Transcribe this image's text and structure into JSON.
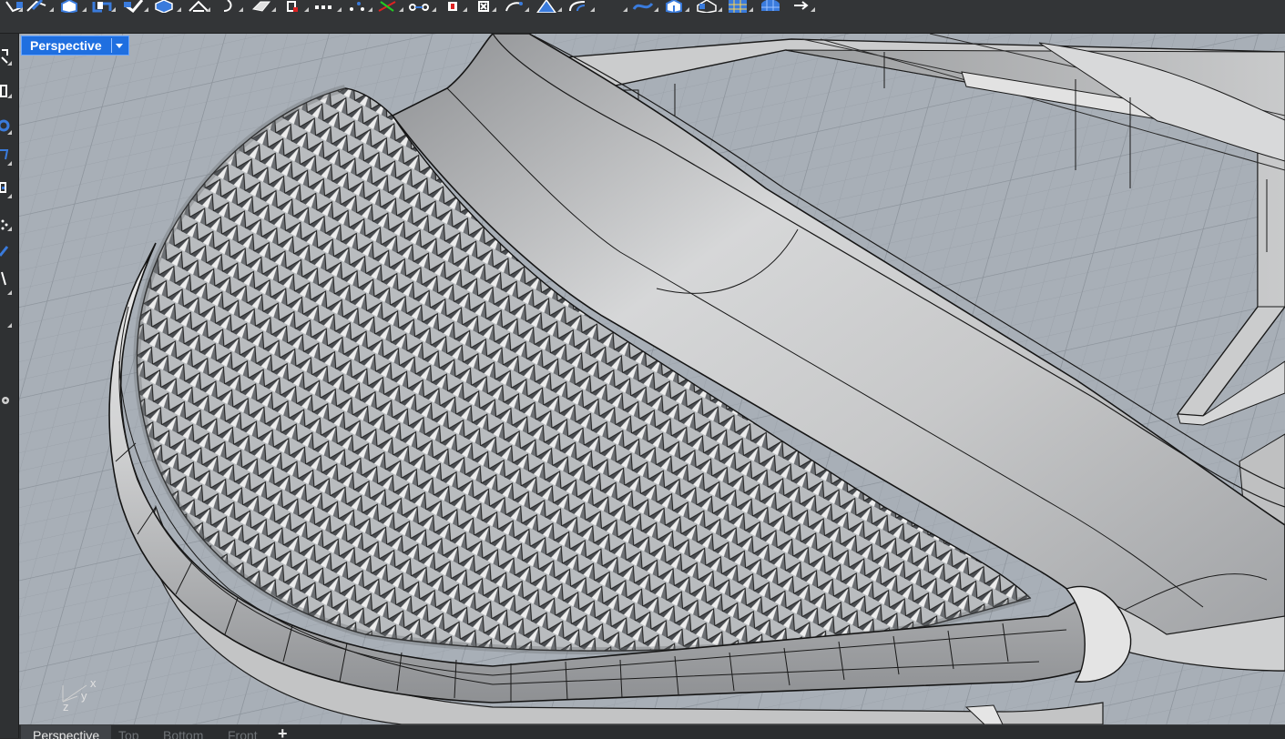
{
  "toolbar": {
    "icons": [
      "surface-icon",
      "extrude-icon",
      "box-icon",
      "solid-tools-icon",
      "boolean-icon",
      "mesh-icon",
      "transform-icon",
      "rotate-icon",
      "analyze-icon",
      "render-icon",
      "array-icon",
      "points-icon",
      "curve-tools-icon",
      "snap-icon",
      "dimension-icon",
      "layer-icon",
      "curve-icon",
      "pyramid-icon",
      "fillet-icon",
      "blend-icon",
      "solid-icon",
      "cage-icon",
      "grid-icon",
      "sphere-mesh-icon",
      "more-icon"
    ],
    "accent": "#3a7bdc"
  },
  "left_toolbar": {
    "icons": [
      "select-icon",
      "point-icon",
      "circle-icon",
      "polygon-icon",
      "rectangle-icon",
      "dots-icon",
      "pencil-icon",
      "line-icon",
      "settings-gear-icon"
    ]
  },
  "viewport": {
    "title": "Perspective",
    "title_color": "#1f6fe0",
    "axis": {
      "x": "x",
      "y": "y",
      "z": "z"
    }
  },
  "tabs": [
    {
      "label": "Perspective",
      "active": true
    },
    {
      "label": "Top",
      "active": false
    },
    {
      "label": "Bottom",
      "active": false
    },
    {
      "label": "Front",
      "active": false
    }
  ],
  "add_tab_label": "+"
}
